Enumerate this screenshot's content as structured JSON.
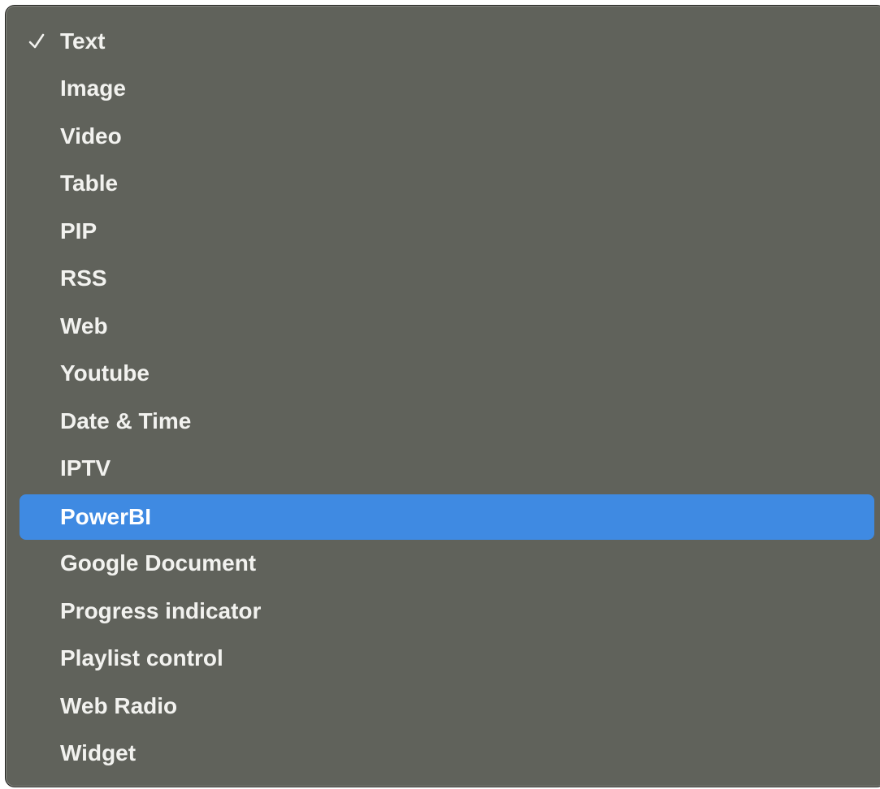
{
  "menu": {
    "selected_index": 0,
    "highlighted_index": 10,
    "items": [
      {
        "label": "Text",
        "checked": true
      },
      {
        "label": "Image"
      },
      {
        "label": "Video"
      },
      {
        "label": "Table"
      },
      {
        "label": "PIP"
      },
      {
        "label": "RSS"
      },
      {
        "label": "Web"
      },
      {
        "label": "Youtube"
      },
      {
        "label": "Date & Time"
      },
      {
        "label": "IPTV"
      },
      {
        "label": "PowerBI",
        "highlighted": true
      },
      {
        "label": "Google Document"
      },
      {
        "label": "Progress indicator"
      },
      {
        "label": "Playlist control"
      },
      {
        "label": "Web Radio"
      },
      {
        "label": "Widget"
      }
    ],
    "checkmark_icon": "checkmark-icon",
    "colors": {
      "menu_background": "#60625b",
      "highlight": "#3f8ae2",
      "text": "#f2f2ef"
    }
  }
}
